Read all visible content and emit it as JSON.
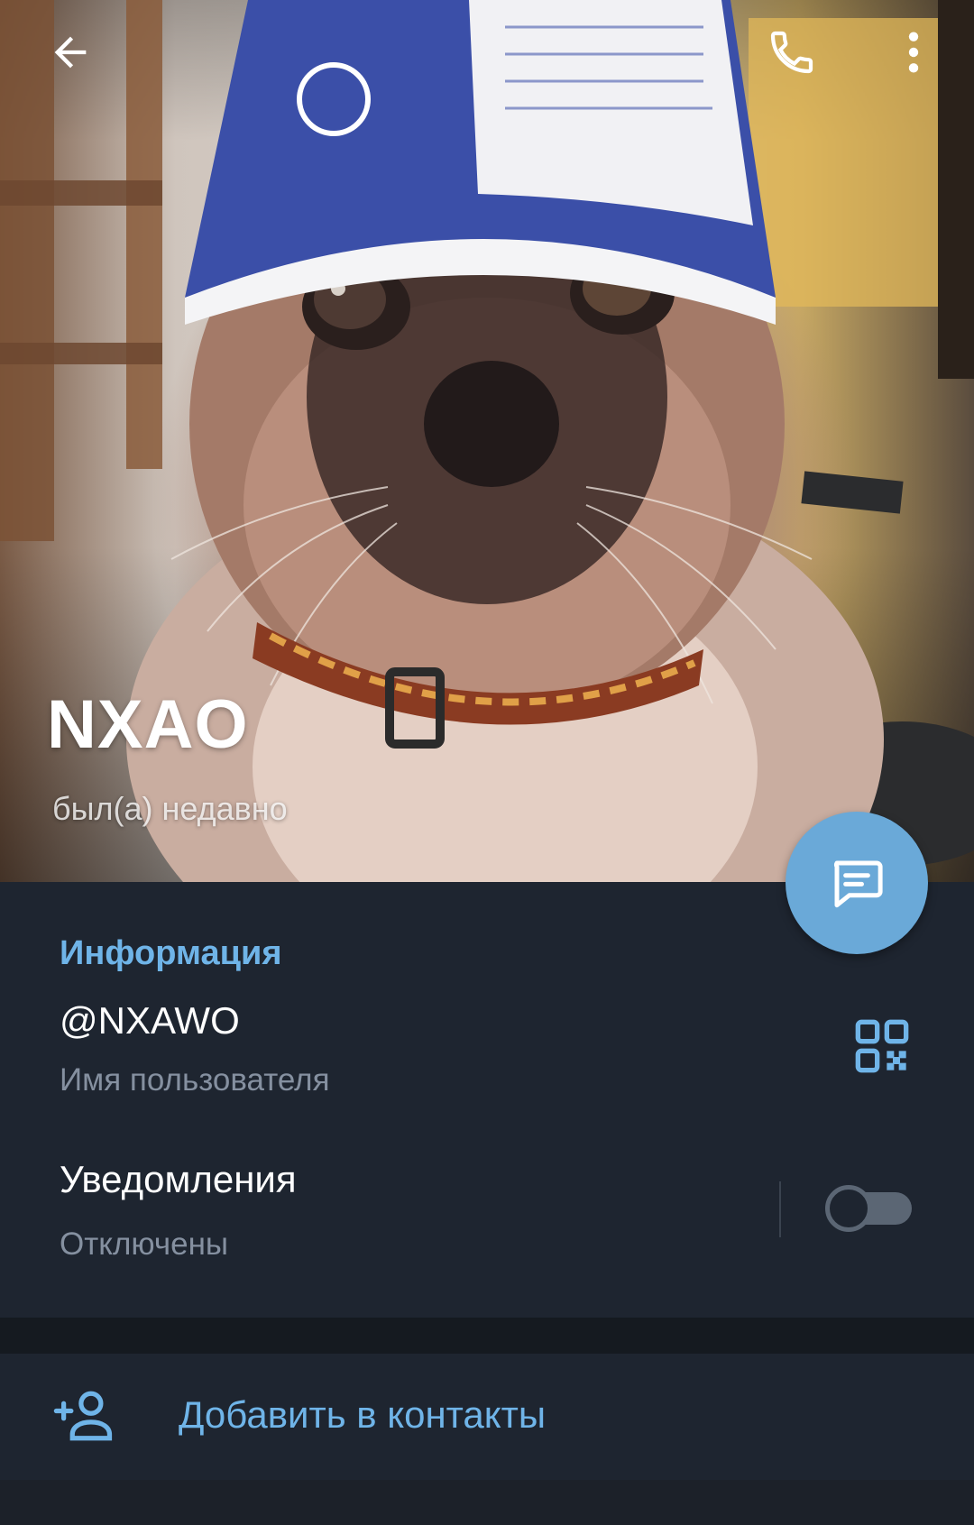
{
  "header": {
    "name": "NXAO",
    "status": "был(а) недавно",
    "photo_description_icon": "profile-photo-cat",
    "back_icon": "arrow-left-icon",
    "call_icon": "phone-icon",
    "more_icon": "more-vertical-icon"
  },
  "fab": {
    "icon": "message-icon",
    "color": "#6aa9d8"
  },
  "info": {
    "title": "Информация",
    "username": "@NXAWO",
    "username_label": "Имя пользователя",
    "qr_icon": "qr-code-icon"
  },
  "notifications": {
    "title": "Уведомления",
    "status": "Отключены",
    "enabled": false
  },
  "add_contact": {
    "label": "Добавить в контакты",
    "icon": "add-person-icon"
  },
  "colors": {
    "accent": "#6fb4e8",
    "background": "#1e2530",
    "secondary_text": "#8590a0"
  }
}
